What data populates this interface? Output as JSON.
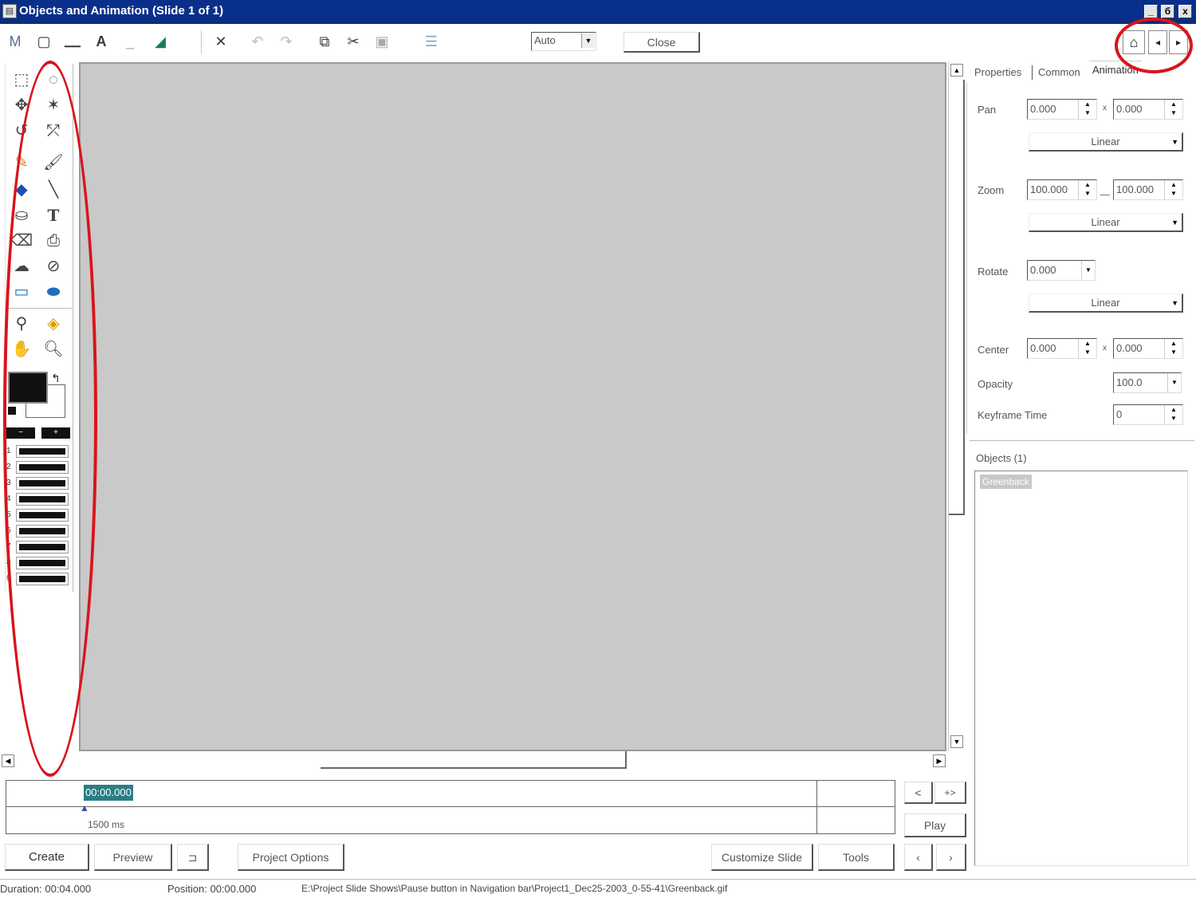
{
  "window": {
    "title": "Objects and Animation (Slide 1 of 1)",
    "controls": [
      "_",
      "б",
      "x"
    ]
  },
  "toolbar": {
    "zoom_value": "Auto",
    "close_label": "Close"
  },
  "palette": {
    "swatch_numbers": [
      "1",
      "2",
      "3",
      "4",
      "5",
      "6",
      "7",
      "8",
      "9"
    ],
    "minus_label": "−",
    "plus_label": "+"
  },
  "tabs": {
    "properties": "Properties",
    "common": "Common",
    "animation": "Animation"
  },
  "properties": {
    "pan_label": "Pan",
    "pan_x": "0.000",
    "pan_y": "0.000",
    "pan_mode": "Linear",
    "zoom_label": "Zoom",
    "zoom_x": "100.000",
    "zoom_y": "100.000",
    "zoom_mode": "Linear",
    "rotate_label": "Rotate",
    "rotate_value": "0.000",
    "rotate_mode": "Linear",
    "center_label": "Center",
    "center_x": "0.000",
    "center_y": "0.000",
    "opacity_label": "Opacity",
    "opacity_value": "100.0",
    "keyframe_label": "Keyframe Time",
    "keyframe_value": "0",
    "x_sep": "x"
  },
  "objects": {
    "header": "Objects (1)",
    "items": [
      "Greenback"
    ]
  },
  "timeline": {
    "current_time": "00:00.000",
    "duration_marker": "1500 ms",
    "prev_label": "<",
    "next_label": "+>",
    "play_label": "Play"
  },
  "bottom_buttons": {
    "create": "Create",
    "preview": "Preview",
    "project_options": "Project Options",
    "customize_slide": "Customize Slide",
    "tools": "Tools",
    "nav_prev": "‹",
    "nav_next": "›"
  },
  "status": {
    "duration": "Duration: 00:04.000",
    "position": "Position: 00:00.000",
    "path": "E:\\Project Slide Shows\\Pause button in Navigation bar\\Project1_Dec25-2003_0-55-41\\Greenback.gif"
  },
  "colors": {
    "highlight": "#d9141b",
    "titlebar": "#0a2f8a",
    "canvas": "#c9c9c9",
    "timeline_chip": "#2b7d84"
  }
}
